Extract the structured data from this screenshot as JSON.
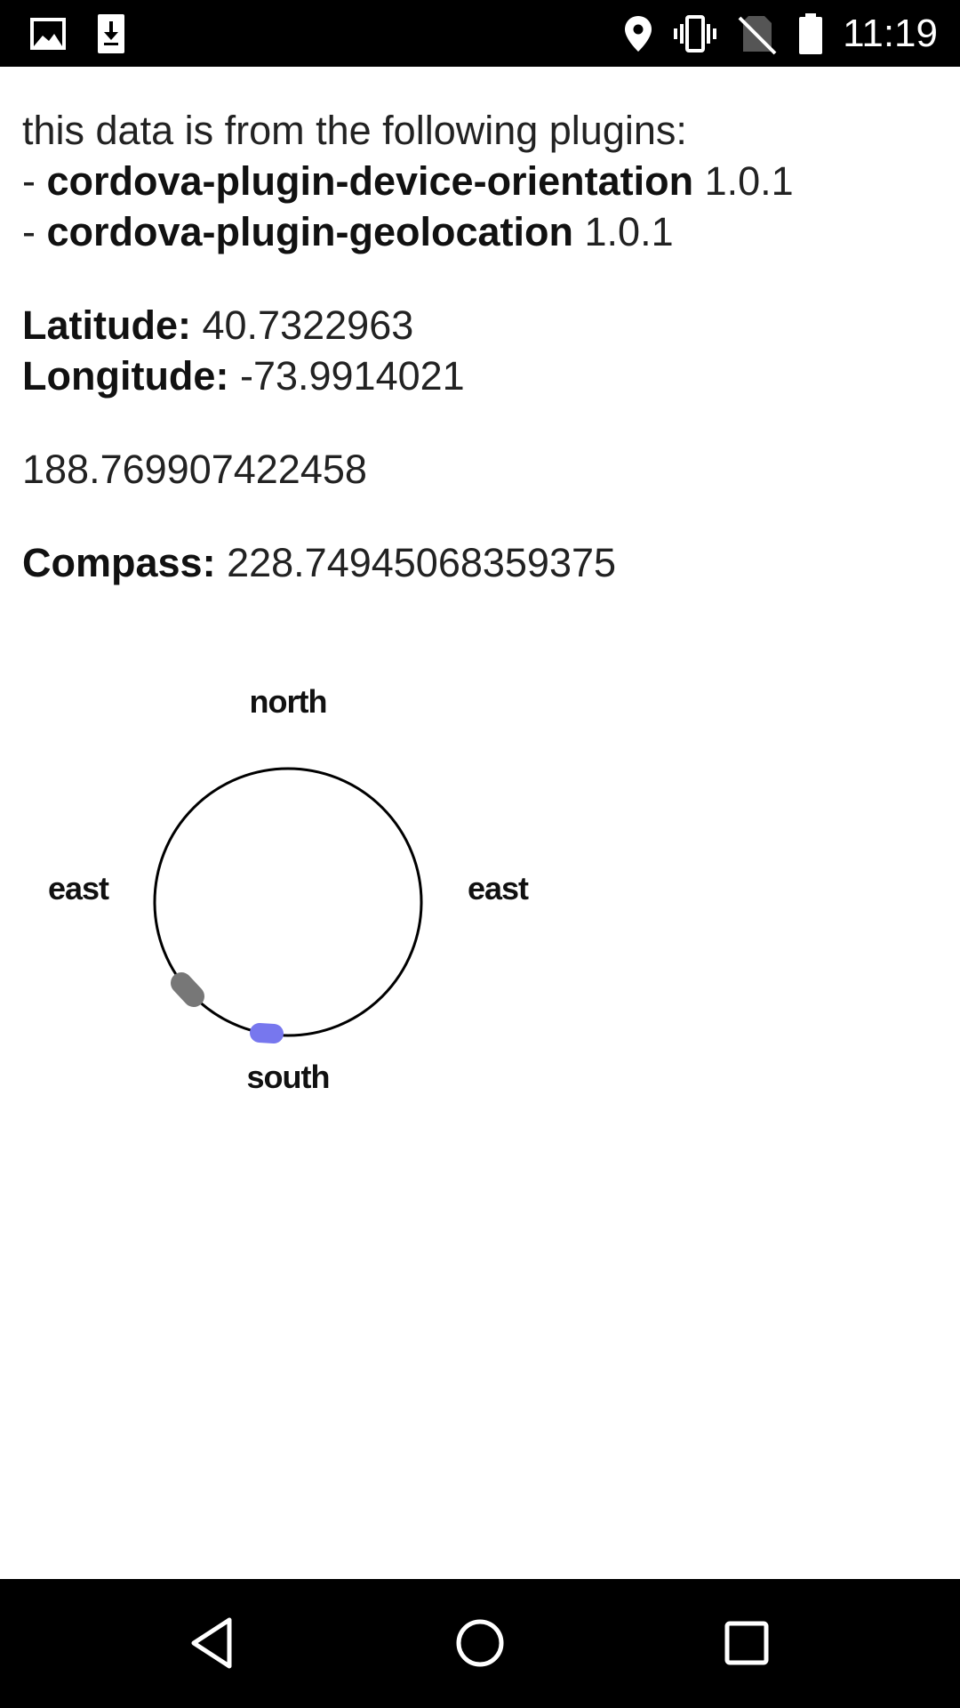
{
  "status_bar": {
    "time": "11:19",
    "left_icons": [
      "image-icon",
      "download-icon"
    ],
    "right_icons": [
      "location-icon",
      "vibrate-icon",
      "no-sim-icon",
      "battery-icon"
    ]
  },
  "intro": {
    "heading": "this data is from the following plugins:",
    "plugins": [
      {
        "prefix": "- ",
        "name": "cordova-plugin-device-orientation",
        "version": "1.0.1"
      },
      {
        "prefix": "- ",
        "name": "cordova-plugin-geolocation",
        "version": "1.0.1"
      }
    ]
  },
  "location": {
    "latitude_label": "Latitude:",
    "latitude_value": "40.7322963",
    "longitude_label": "Longitude:",
    "longitude_value": "-73.9914021"
  },
  "heading_value": "188.769907422458",
  "compass": {
    "label": "Compass:",
    "value": "228.74945068359375",
    "north_label": "north",
    "south_label": "south",
    "west_label": "east",
    "east_label": "east",
    "marker_gray_color": "#777777",
    "marker_blue_color": "#7777ee"
  },
  "nav_bar": {
    "buttons": [
      "back-icon",
      "home-icon",
      "recents-icon"
    ]
  }
}
